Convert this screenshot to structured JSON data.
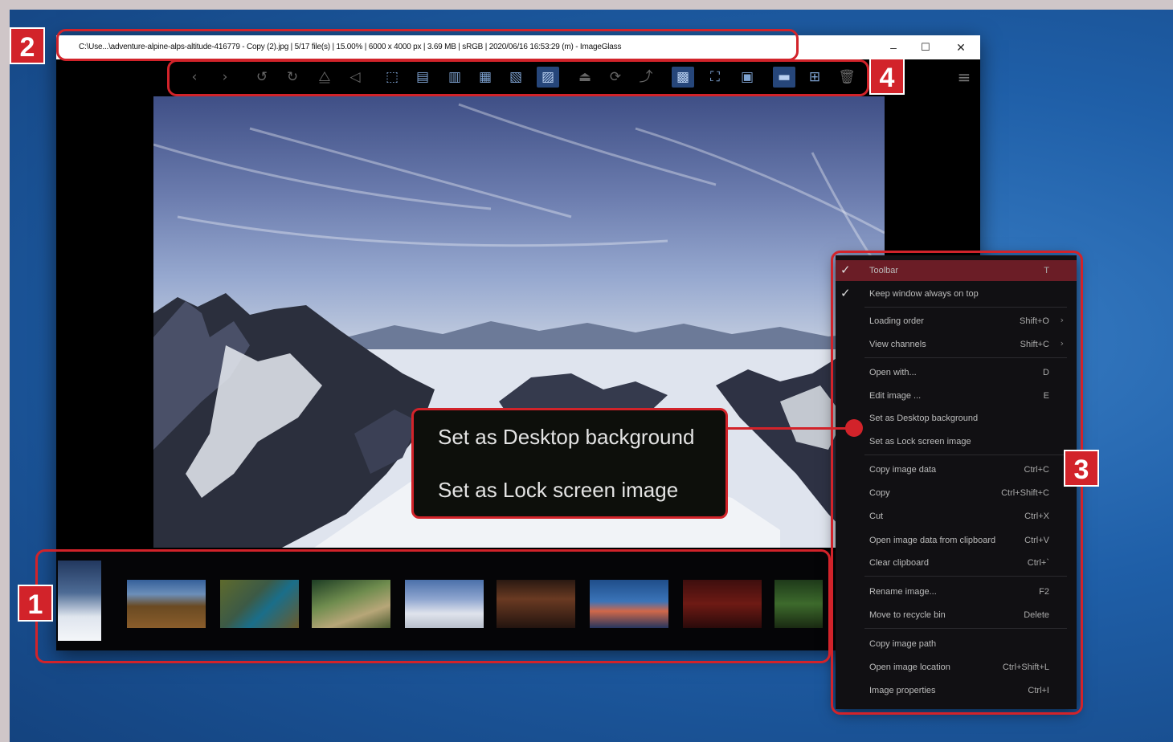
{
  "window": {
    "title": "C:\\Use...\\adventure-alpine-alps-altitude-416779 - Copy (2).jpg | 5/17 file(s) | 15.00% | 6000 x 4000 px | 3.69 MB | sRGB | 2020/06/16 16:53:29 (m) - ImageGlass",
    "controls": {
      "minimize": "–",
      "maximize": "☐",
      "close": "✕"
    }
  },
  "toolbar": {
    "icons": [
      "previous-image-icon",
      "next-image-icon",
      "rotate-left-icon",
      "rotate-right-icon",
      "flip-horizontal-icon",
      "flip-vertical-icon",
      "auto-zoom-icon",
      "lock-zoom-icon",
      "scale-to-width-icon",
      "scale-to-height-icon",
      "scale-to-fit-icon",
      "scale-to-fill-icon",
      "open-file-icon",
      "refresh-icon",
      "goto-image-icon",
      "checkerboard-icon",
      "fullscreen-icon",
      "slideshow-icon",
      "thumbnail-bar-icon",
      "frameless-icon",
      "delete-icon"
    ],
    "menu_icon": "hamburger-menu-icon"
  },
  "context_menu": {
    "items": [
      {
        "label": "Toolbar",
        "shortcut": "T",
        "checked": true,
        "highlighted": true
      },
      {
        "label": "Keep window always on top",
        "shortcut": "",
        "checked": true
      },
      {
        "label": "Loading order",
        "shortcut": "Shift+O",
        "submenu": true
      },
      {
        "label": "View channels",
        "shortcut": "Shift+C",
        "submenu": true
      },
      {
        "label": "Open with...",
        "shortcut": "D"
      },
      {
        "label": "Edit image ...",
        "shortcut": "E"
      },
      {
        "label": "Set as Desktop background",
        "shortcut": ""
      },
      {
        "label": "Set as Lock screen image",
        "shortcut": ""
      },
      {
        "label": "Copy image data",
        "shortcut": "Ctrl+C"
      },
      {
        "label": "Copy",
        "shortcut": "Ctrl+Shift+C"
      },
      {
        "label": "Cut",
        "shortcut": "Ctrl+X"
      },
      {
        "label": "Open image data from clipboard",
        "shortcut": "Ctrl+V"
      },
      {
        "label": "Clear clipboard",
        "shortcut": "Ctrl+`"
      },
      {
        "label": "Rename image...",
        "shortcut": "F2"
      },
      {
        "label": "Move to recycle bin",
        "shortcut": "Delete"
      },
      {
        "label": "Copy image path",
        "shortcut": ""
      },
      {
        "label": "Open image location",
        "shortcut": "Ctrl+Shift+L"
      },
      {
        "label": "Image properties",
        "shortcut": "Ctrl+I"
      }
    ]
  },
  "callout": {
    "line1": "Set as Desktop background",
    "line2": "Set as Lock screen image"
  },
  "badges": {
    "thumbnails": "1",
    "titlebar": "2",
    "menu": "3",
    "toolbar": "4"
  },
  "colors": {
    "accent": "#d2232a",
    "menu_highlight": "#6b1d26",
    "desktop": "#1f5fa8"
  }
}
